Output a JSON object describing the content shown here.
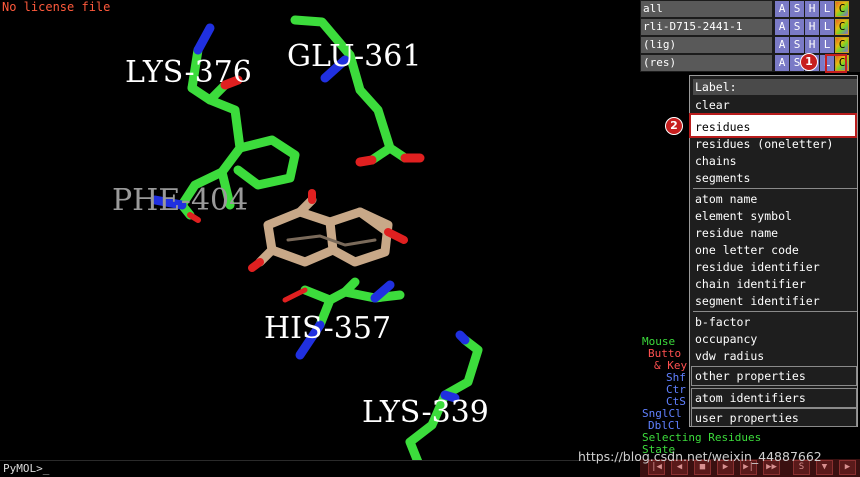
{
  "viewport": {
    "license_text": "No license file",
    "residue_labels": [
      {
        "text": "LYS-376",
        "color": "#ffffff"
      },
      {
        "text": "GLU-361",
        "color": "#ffffff"
      },
      {
        "text": "PHE-404",
        "color": "#9a9a9a"
      },
      {
        "text": "HIS-357",
        "color": "#ffffff"
      },
      {
        "text": "LYS-339",
        "color": "#ffffff"
      }
    ]
  },
  "command_line": {
    "prompt": "PyMOL>_"
  },
  "object_panel": {
    "objects": [
      {
        "name": "all"
      },
      {
        "name": "rli-D715-2441-1"
      },
      {
        "name": "(lig)"
      },
      {
        "name": "(res)"
      }
    ],
    "buttons": [
      "A",
      "S",
      "H",
      "L",
      "C"
    ]
  },
  "mouse_panel": {
    "lines": [
      {
        "text": "Mouse",
        "color": "#3cdc3c"
      },
      {
        "text": "Butto",
        "color": "#ff5050"
      },
      {
        "text": "& Key",
        "color": "#ff5050"
      },
      {
        "text": "Shf",
        "color": "#6080ff"
      },
      {
        "text": "Ctr",
        "color": "#6080ff"
      },
      {
        "text": "CtS",
        "color": "#6080ff"
      },
      {
        "text": "SnglCl",
        "color": "#6080ff"
      },
      {
        "text": "DblCl",
        "color": "#6080ff"
      },
      {
        "text": "Selecting Residues",
        "color": "#3cdc3c"
      },
      {
        "text": "State",
        "color": "#3cdc3c"
      }
    ]
  },
  "label_menu": {
    "title": "Label:",
    "items_top": [
      "clear",
      "residues",
      "residues (oneletter)",
      "chains",
      "segments"
    ],
    "items_names": [
      "atom name",
      "element symbol",
      "residue name",
      "one letter code",
      "residue identifier",
      "chain identifier",
      "segment identifier"
    ],
    "items_props": [
      "b-factor",
      "occupancy",
      "vdw radius"
    ],
    "other_properties": "other properties",
    "atom_identifiers": "atom identifiers",
    "user_properties": "user properties"
  },
  "annotations": {
    "step1": "1",
    "step2": "2"
  },
  "playbar": {
    "buttons": [
      "|◀",
      "◀",
      "■",
      "▶",
      "▶|",
      "▶▶",
      "S",
      "▼",
      "▶"
    ]
  },
  "watermark": "https://blog.csdn.net/weixin_44887662",
  "colors": {
    "carbon": "#3cdc3c",
    "nitrogen": "#2030e0",
    "oxygen": "#e02020",
    "ligand": "#c8a888"
  }
}
